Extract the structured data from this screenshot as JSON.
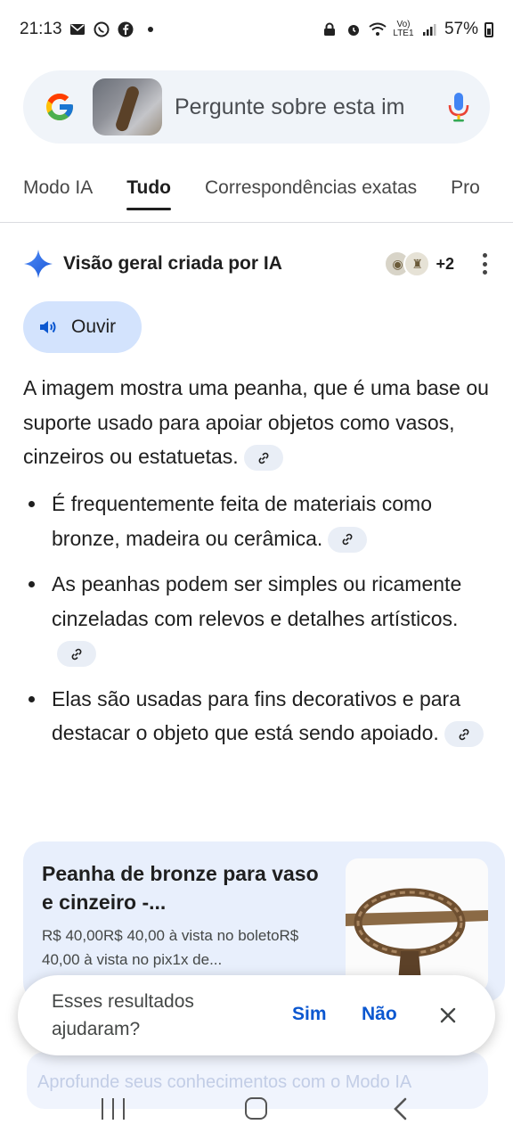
{
  "status_bar": {
    "time": "21:13",
    "network": "Vo) LTE1",
    "battery": "57%"
  },
  "search": {
    "text": "Pergunte sobre esta im"
  },
  "tabs": [
    {
      "label": "Modo IA"
    },
    {
      "label": "Tudo"
    },
    {
      "label": "Correspondências exatas"
    },
    {
      "label": "Pro"
    }
  ],
  "ai_overview": {
    "title": "Visão geral criada por IA",
    "source_count": "+2",
    "listen_label": "Ouvir",
    "intro": "A imagem mostra uma peanha, que é uma base ou suporte usado para apoiar objetos como vasos, cinzeiros ou estatuetas.",
    "bullets": [
      {
        "text": "É frequentemente feita de materiais como bronze, madeira ou cerâmica."
      },
      {
        "text": "As peanhas podem ser simples ou ricamente cinzeladas com relevos e detalhes artísticos."
      },
      {
        "text": "Elas são usadas para fins decorativos e para destacar o objeto que está sendo apoiado."
      }
    ]
  },
  "result_card": {
    "title": "Peanha de bronze para vaso e cinzeiro -...",
    "description": "R$ 40,00R$ 40,00 à vista no boletoR$ 40,00 à vista no pix1x de..."
  },
  "footer": {
    "deep_dive": "Aprofunde seus conhecimentos com o Modo IA"
  },
  "feedback": {
    "question": "Esses resultados ajudaram?",
    "yes": "Sim",
    "no": "Não"
  },
  "colors": {
    "accent": "#0b57d0",
    "chip_bg": "#d3e3fd",
    "card_bg": "#e8effc"
  },
  "icons": {
    "google": "google-logo",
    "mic": "mic-icon",
    "sparkle": "sparkle-icon",
    "speaker": "speaker-icon",
    "link": "link-icon",
    "close": "close-icon"
  }
}
